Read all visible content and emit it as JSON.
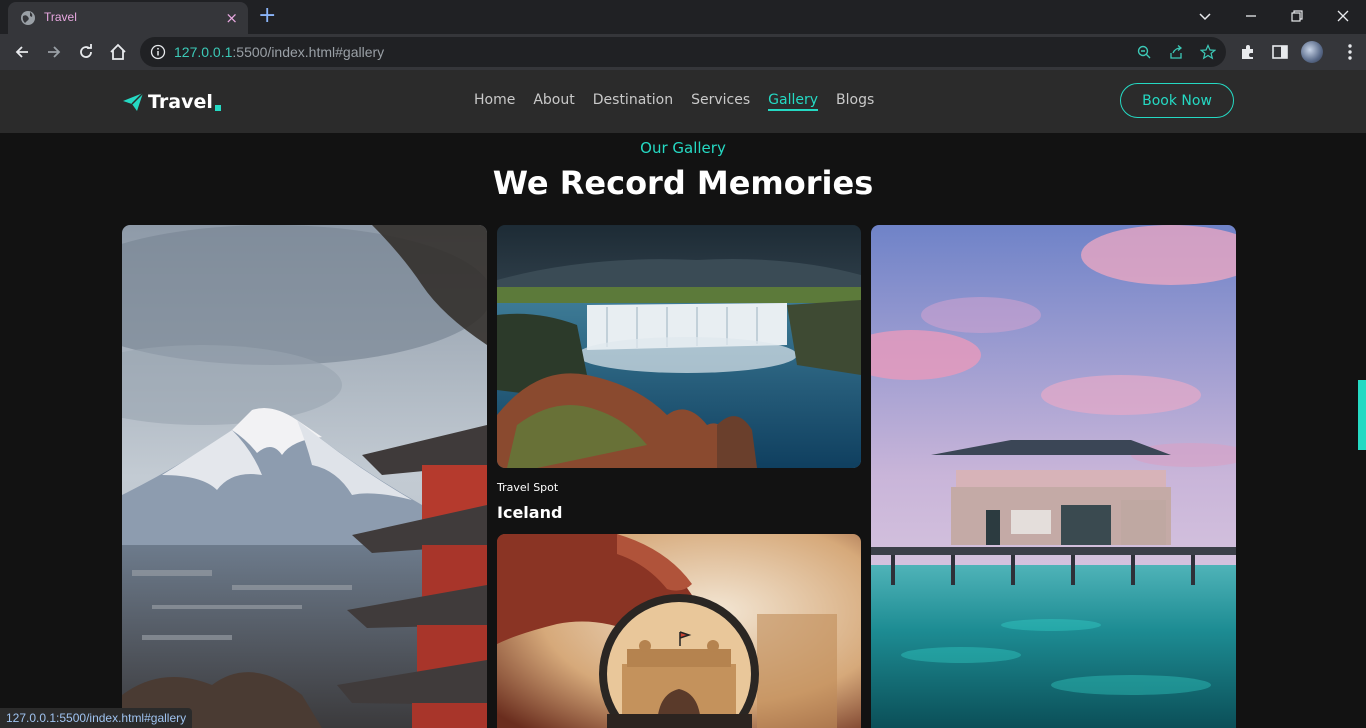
{
  "browser": {
    "tab_title": "Travel",
    "tab_close": "×",
    "new_tab": "+",
    "url_host": "127.0.0.1",
    "url_rest": ":5500/index.html#gallery",
    "status_url": "127.0.0.1:5500/index.html#gallery"
  },
  "site": {
    "logo_text": "Travel",
    "nav": [
      "Home",
      "About",
      "Destination",
      "Services",
      "Gallery",
      "Blogs"
    ],
    "active_nav": "Gallery",
    "book_button": "Book Now",
    "accent": "#25d9c3"
  },
  "gallery": {
    "subtitle": "Our Gallery",
    "heading": "We Record Memories",
    "card": {
      "label": "Travel Spot",
      "name": "Iceland"
    }
  }
}
